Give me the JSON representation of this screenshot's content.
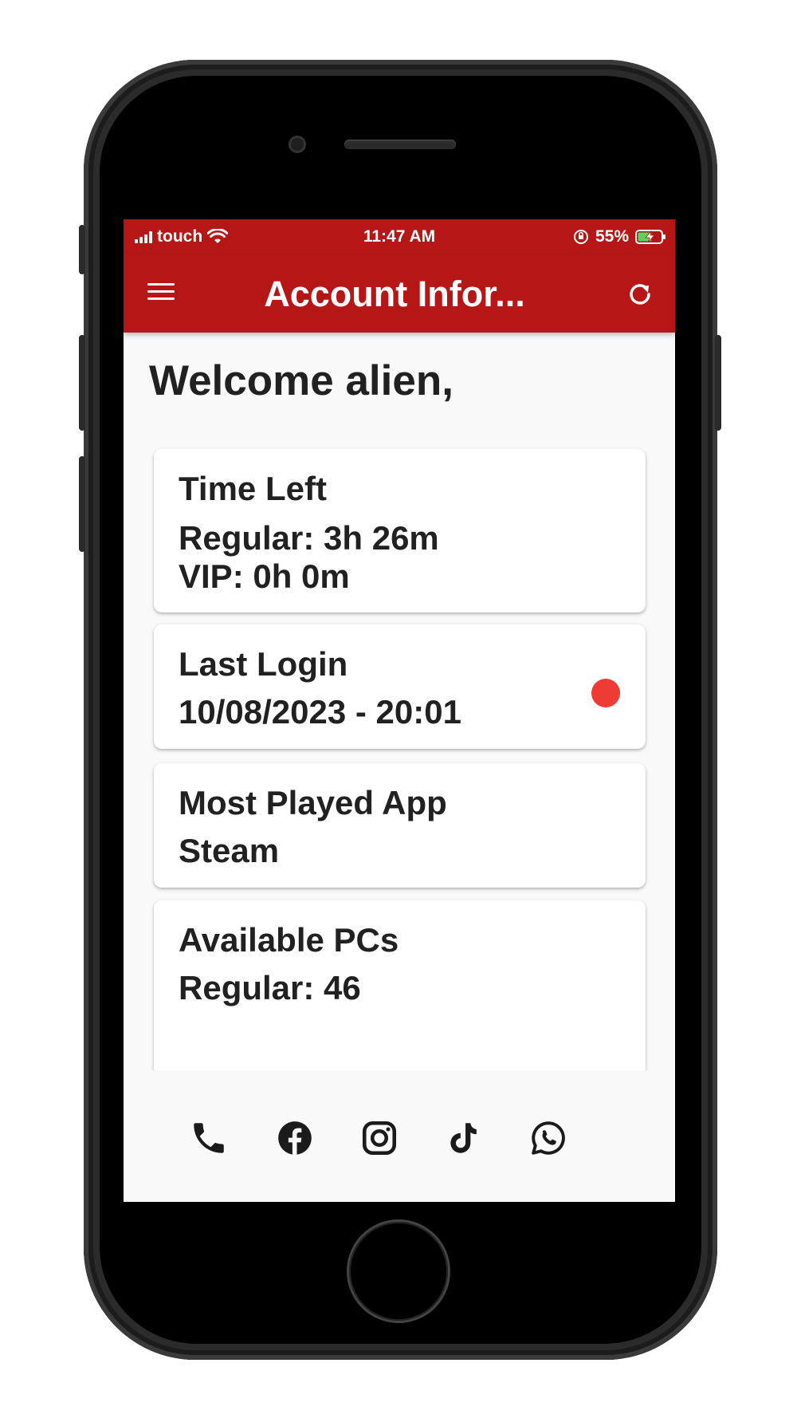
{
  "status_bar": {
    "carrier": "touch",
    "time": "11:47 AM",
    "battery": "55%"
  },
  "app_bar": {
    "title": "Account Infor..."
  },
  "welcome": "Welcome alien,",
  "cards": {
    "time_left": {
      "title": "Time Left",
      "regular": "Regular: 3h 26m",
      "vip": "VIP: 0h 0m"
    },
    "last_login": {
      "title": "Last Login",
      "value": "10/08/2023 - 20:01",
      "status_color": "#ef3b35"
    },
    "most_played": {
      "title": "Most Played App",
      "value": "Steam"
    },
    "available_pcs": {
      "title": "Available PCs",
      "regular": "Regular: 46"
    }
  },
  "bottom_icons": [
    "phone-icon",
    "facebook-icon",
    "instagram-icon",
    "tiktok-icon",
    "whatsapp-icon"
  ],
  "colors": {
    "primary": "#b71616",
    "background": "#f9f9f9",
    "text": "#212121"
  }
}
